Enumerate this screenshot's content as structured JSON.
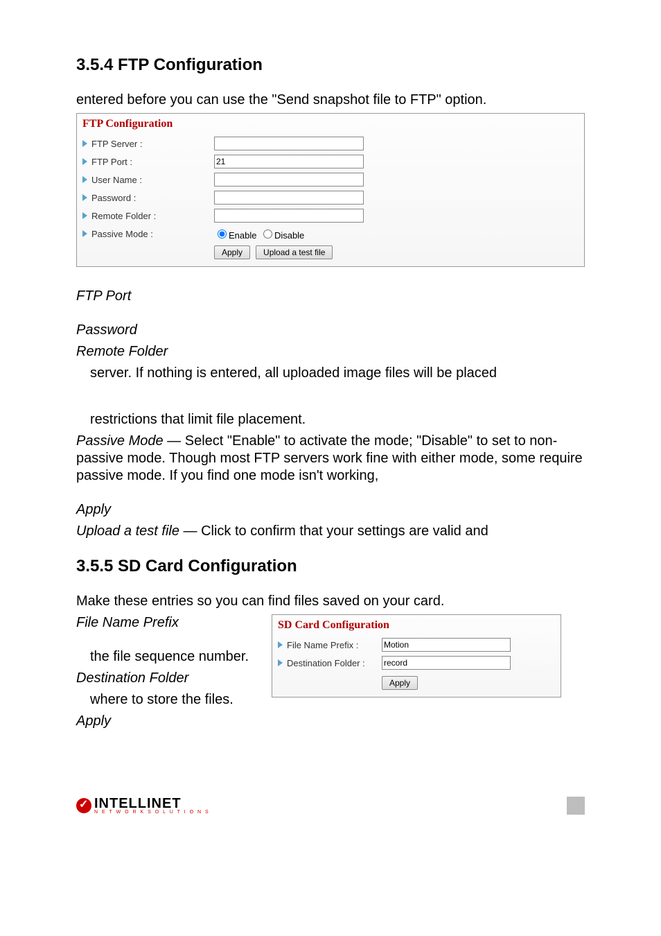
{
  "sec354_title": "3.5.4  FTP Configuration",
  "intro354": "entered before you can use the \"Send snapshot file to FTP\" option.",
  "ftp_panel": {
    "title": "FTP Configuration",
    "labels": {
      "server": "FTP Server :",
      "port": "FTP Port :",
      "user": "User Name :",
      "pass": "Password :",
      "folder": "Remote Folder :",
      "passive": "Passive Mode :"
    },
    "values": {
      "server": "",
      "port": "21",
      "user": "",
      "pass": "",
      "folder": ""
    },
    "radio_enable": "Enable",
    "radio_disable": "Disable",
    "apply": "Apply",
    "upload": "Upload a test file"
  },
  "defs": {
    "ftp_port": "FTP Port",
    "password": "Password",
    "remote_folder": "Remote Folder",
    "remote_folder_desc": "server. If nothing is entered, all uploaded image files will be placed",
    "restrictions": "restrictions that limit file placement.",
    "passive_mode_label": "Passive Mode",
    "passive_mode_desc": " — Select \"Enable\" to activate the mode; \"Disable\" to set to non-passive mode. Though most FTP servers work fine with either mode, some require passive mode. If you find one mode isn't working,",
    "apply": "Apply",
    "upload_label": "Upload a test file",
    "upload_desc": " — Click to confirm that your settings are valid and"
  },
  "sec355_title": "3.5.5  SD Card Configuration",
  "intro355": "Make these entries so you can find files saved on your card.",
  "sd_left": {
    "file_prefix": "File Name Prefix",
    "file_seq": "the file sequence number.",
    "dest_folder": "Destination Folder",
    "where": "where to store the files.",
    "apply": "Apply"
  },
  "sd_panel": {
    "title": "SD Card Configuration",
    "label_prefix": "File Name Prefix :",
    "label_dest": "Destination Folder :",
    "val_prefix": "Motion",
    "val_dest": "record",
    "apply": "Apply"
  },
  "logo": {
    "main": "INTELLINET",
    "sub": "N E T W O R K   S O L U T I O N S"
  }
}
